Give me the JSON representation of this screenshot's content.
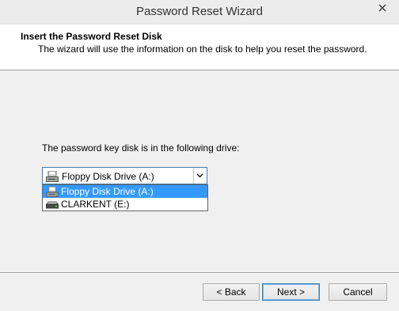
{
  "window": {
    "title": "Password Reset Wizard",
    "close_icon": "close-icon"
  },
  "header": {
    "title": "Insert the Password Reset Disk",
    "description": "The wizard will use the information on the disk to help you reset the password."
  },
  "body": {
    "prompt": "The password key disk is in the following drive:"
  },
  "drive_select": {
    "selected": "Floppy Disk Drive (A:)",
    "options": [
      {
        "label": "Floppy Disk Drive (A:)",
        "icon": "floppy-drive-icon",
        "highlighted": true
      },
      {
        "label": "CLARKENT (E:)",
        "icon": "removable-drive-icon",
        "highlighted": false
      }
    ]
  },
  "buttons": {
    "back": "< Back",
    "next": "Next >",
    "cancel": "Cancel"
  },
  "colors": {
    "selection": "#3399ff",
    "focus_border": "#3c7fb1"
  }
}
